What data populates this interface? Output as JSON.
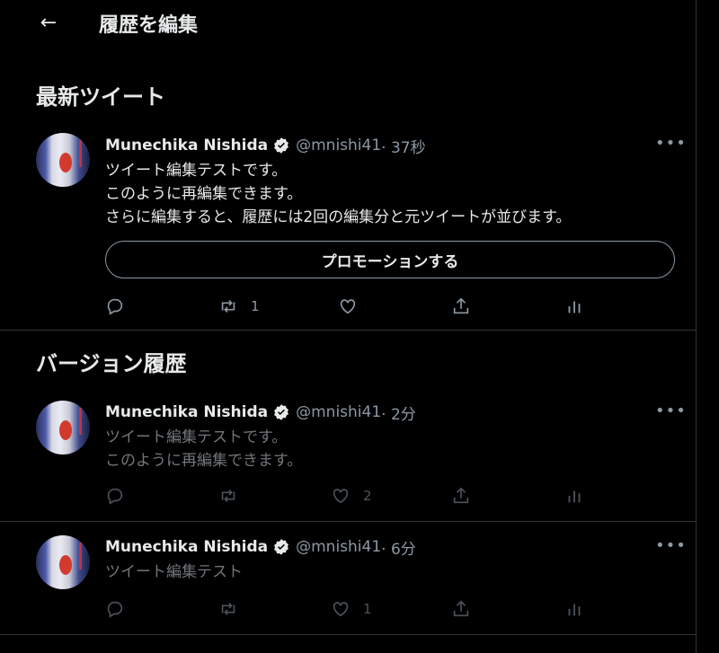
{
  "header": {
    "title": "履歴を編集"
  },
  "sections": {
    "latest": "最新ツイート",
    "history": "バージョン履歴"
  },
  "user": {
    "name": "Munechika Nishida",
    "handle": "@mnishi41"
  },
  "latest": {
    "time": " · 37秒",
    "lines": "ツイート編集テストです。\nこのように再編集できます。\nさらに編集すると、履歴には2回の編集分と元ツイートが並びます。",
    "promote": "プロモーションする",
    "retweets": "1"
  },
  "versions": [
    {
      "time": " · 2分",
      "lines": "ツイート編集テストです。\nこのように再編集できます。",
      "likes": "2"
    },
    {
      "time": " · 6分",
      "lines": "ツイート編集テスト",
      "likes": "1"
    }
  ],
  "icons": [
    "back-arrow-icon",
    "verified-badge-icon",
    "more-icon",
    "reply-icon",
    "retweet-icon",
    "like-icon",
    "share-icon",
    "analytics-icon"
  ],
  "colors": {
    "background": "#000000",
    "text": "#e7e9ea",
    "secondary": "#8b98a5",
    "divider": "#2f3336"
  }
}
